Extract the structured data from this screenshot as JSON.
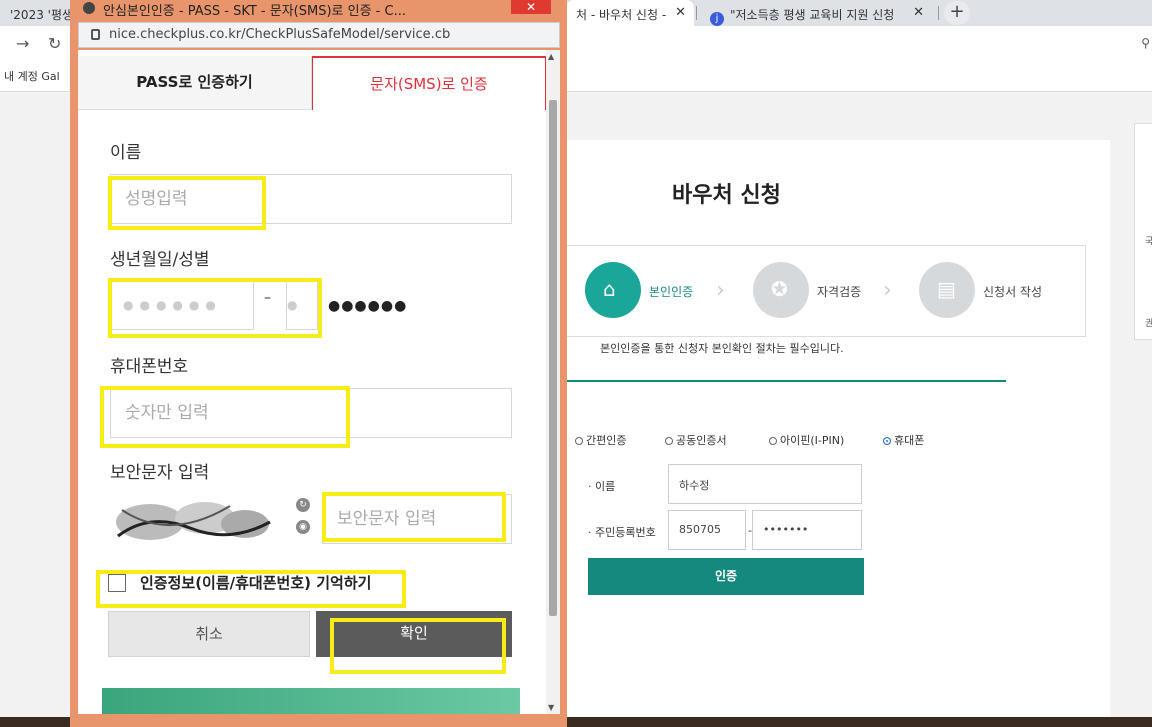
{
  "browser": {
    "tabs": [
      {
        "label": "'2023 '평생"
      },
      {
        "label": "처 - 바우처 신청 -"
      },
      {
        "label": "\"저소득층 평생 교육비 지원 신청"
      }
    ],
    "new_tab": "+",
    "close_glyph": "✕",
    "bookmark_text": "내 계정 Gal",
    "zoom_icon": "magnifier-icon"
  },
  "popup": {
    "title": "안심본인인증 - PASS - SKT - 문자(SMS)로 인증 - C...",
    "url": "nice.checkplus.co.kr/CheckPlusSafeModel/service.cb",
    "tabs": {
      "pass": "PASS로 인증하기",
      "sms": "문자(SMS)로 인증"
    },
    "name_label": "이름",
    "name_placeholder": "성명입력",
    "birth_label": "생년월일/성별",
    "birth_dots": "●●●●●●",
    "gender_dot": "●",
    "masked_rest": "●●●●●●",
    "dash": "–",
    "phone_label": "휴대폰번호",
    "phone_placeholder": "숫자만 입력",
    "captcha_label": "보안문자 입력",
    "captcha_placeholder": "보안문자 입력",
    "remember_label": "인증정보(이름/휴대폰번호) 기억하기",
    "cancel_label": "취소",
    "confirm_label": "확인"
  },
  "page": {
    "title": "바우처 신청",
    "steps": [
      {
        "label": "본인인증",
        "active": true
      },
      {
        "label": "자격검증",
        "active": false
      },
      {
        "label": "신청서 작성",
        "active": false
      }
    ],
    "notice": "본인인증을 통한 신청자 본인확인 절차는 필수입니다.",
    "radios": [
      {
        "label": "간편인증",
        "selected": false
      },
      {
        "label": "공동인증서",
        "selected": false
      },
      {
        "label": "아이핀(I-PIN)",
        "selected": false
      },
      {
        "label": "휴대폰",
        "selected": true
      }
    ],
    "name_label": "이름",
    "name_value": "하수정",
    "rrn_label": "주민등록번호",
    "rrn_front": "850705",
    "rrn_dash": "-",
    "rrn_back": "•••••••",
    "auth_button": "인증",
    "right_panel": [
      "국",
      "권"
    ]
  },
  "colors": {
    "accent": "#16897e",
    "sms_red": "#e0303a",
    "highlight": "#f7ec13",
    "popup_frame": "#e9956b"
  }
}
